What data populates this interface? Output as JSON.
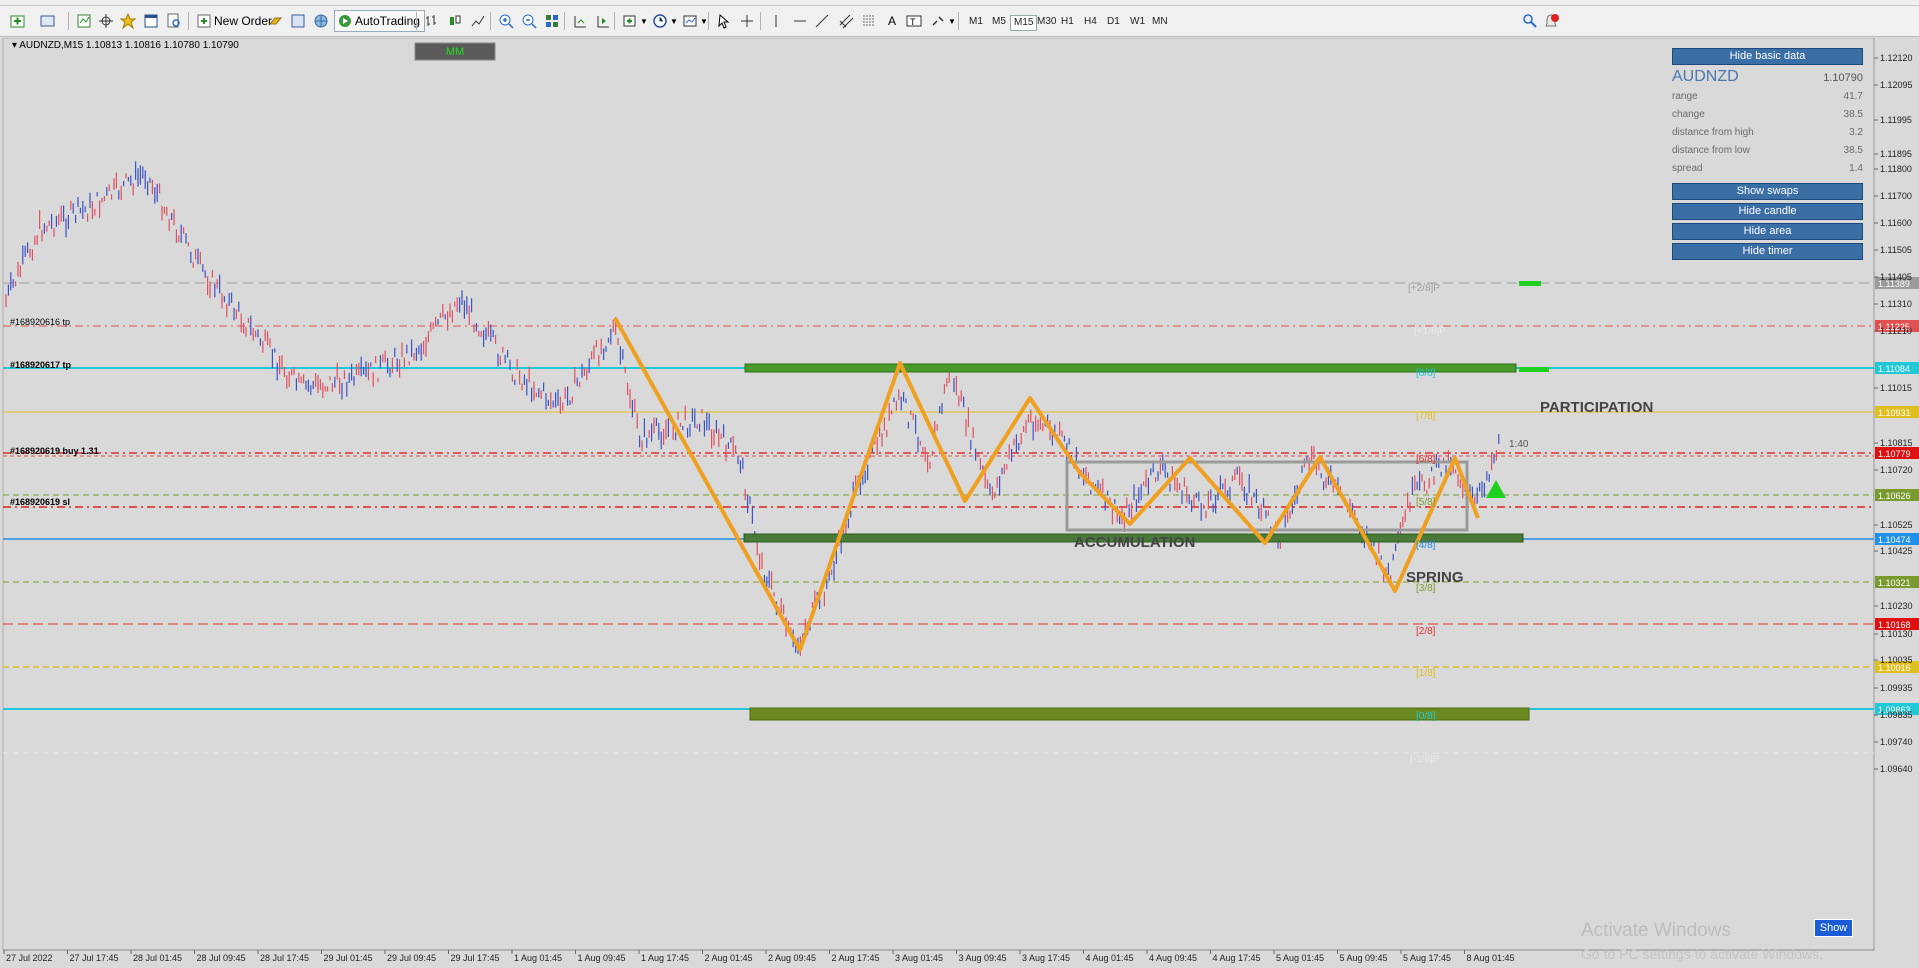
{
  "toolbar": {
    "new_order_label": "New Order",
    "autotrading_label": "AutoTrading",
    "timeframes": [
      "M1",
      "M5",
      "M15",
      "M30",
      "H1",
      "H4",
      "D1",
      "W1",
      "MN"
    ],
    "active_timeframe": "M15"
  },
  "chart": {
    "header": "AUDNZD,M15  1.10813 1.10816 1.10780 1.10790",
    "mm_label": "MM",
    "price_axis": [
      "1.12120",
      "1.12095",
      "1.11995",
      "1.11895",
      "1.11800",
      "1.11700",
      "1.11600",
      "1.11505",
      "1.11405",
      "1.11310",
      "1.11210",
      "1.11015",
      "1.10815",
      "1.10720",
      "1.10525",
      "1.10425",
      "1.10230",
      "1.10130",
      "1.10035",
      "1.09935",
      "1.09835",
      "1.09740",
      "1.09640"
    ],
    "price_tags": [
      {
        "label": "1.11389",
        "color": "#9a9a9a"
      },
      {
        "label": "1.11225",
        "color": "#e05050"
      },
      {
        "label": "1.11084",
        "color": "#22c8d8"
      },
      {
        "label": "1.10931",
        "color": "#e0c020"
      },
      {
        "label": "1.10779",
        "color": "#e01010"
      },
      {
        "label": "1.10626",
        "color": "#7a9a30"
      },
      {
        "label": "1.10474",
        "color": "#2090e8"
      },
      {
        "label": "1.10321",
        "color": "#7a9a30"
      },
      {
        "label": "1.10168",
        "color": "#e01010"
      },
      {
        "label": "1.10016",
        "color": "#e0c020"
      },
      {
        "label": "1.09863",
        "color": "#22c8d8"
      }
    ],
    "time_axis": [
      "27 Jul 2022",
      "27 Jul 17:45",
      "28 Jul 01:45",
      "28 Jul 09:45",
      "28 Jul 17:45",
      "29 Jul 01:45",
      "29 Jul 09:45",
      "29 Jul 17:45",
      "1 Aug 01:45",
      "1 Aug 09:45",
      "1 Aug 17:45",
      "2 Aug 01:45",
      "2 Aug 09:45",
      "2 Aug 17:45",
      "3 Aug 01:45",
      "3 Aug 09:45",
      "3 Aug 17:45",
      "4 Aug 01:45",
      "4 Aug 09:45",
      "4 Aug 17:45",
      "5 Aug 01:45",
      "5 Aug 09:45",
      "5 Aug 17:45",
      "8 Aug 01:45"
    ],
    "order_labels": [
      "#168920616 tp",
      "#168920617 tp",
      "#168920619 buy 1.31",
      "#168920619 sl"
    ],
    "murrey_labels": [
      "[+2/8]P",
      "[+1/8]P",
      "[8/8]",
      "[7/8]",
      "[6/8]",
      "[5/8]",
      "[4/8]",
      "[3/8]",
      "[2/8]",
      "[1/8]",
      "[0/8]",
      "[-1/8]P"
    ],
    "annotations": {
      "participation": "PARTICIPATION",
      "accumulation": "ACCUMULATION",
      "spring": "SPRING",
      "timer": "1:40"
    }
  },
  "panel": {
    "hide_basic_data": "Hide basic data",
    "symbol": "AUDNZD",
    "price": "1.10790",
    "rows": [
      {
        "label": "range",
        "value": "41.7"
      },
      {
        "label": "change",
        "value": "38.5"
      },
      {
        "label": "distance from high",
        "value": "3.2"
      },
      {
        "label": "distance from low",
        "value": "38.5"
      },
      {
        "label": "spread",
        "value": "1.4"
      }
    ],
    "show_swaps": "Show swaps",
    "hide_candle": "Hide candle",
    "hide_area": "Hide area",
    "hide_timer": "Hide timer"
  },
  "footer": {
    "activate_title": "Activate Windows",
    "activate_sub": "Go to PC settings to activate Windows.",
    "show_button": "Show"
  }
}
